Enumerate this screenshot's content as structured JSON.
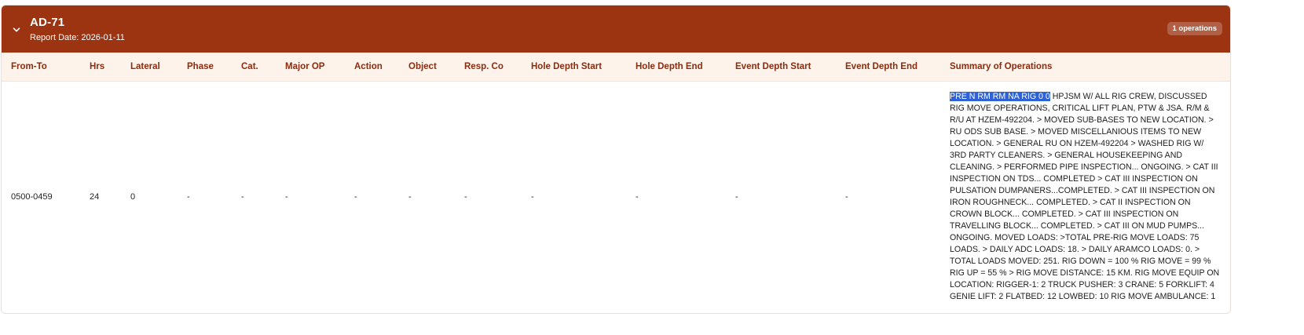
{
  "report": {
    "title": "AD-71",
    "report_date": "Report Date: 2026-01-11",
    "operations_badge": "1 operations"
  },
  "table": {
    "columns": [
      "From-To",
      "Hrs",
      "Lateral",
      "Phase",
      "Cat.",
      "Major OP",
      "Action",
      "Object",
      "Resp. Co",
      "Hole Depth Start",
      "Hole Depth End",
      "Event Depth Start",
      "Event Depth End",
      "Summary of Operations"
    ],
    "rows": [
      {
        "from_to": "0500-0459",
        "hrs": "24",
        "lateral": "0",
        "phase": "-",
        "cat": "-",
        "major_op": "-",
        "action": "-",
        "object": "-",
        "resp_co": "-",
        "hole_depth_start": "-",
        "hole_depth_end": "-",
        "event_depth_start": "-",
        "event_depth_end": "-",
        "summary_selected": "PRE N RM RM NA RIG 0 0",
        "summary_rest": " HPJSM W/ ALL RIG CREW, DISCUSSED RIG MOVE OPERATIONS, CRITICAL LIFT PLAN, PTW & JSA. R/M & R/U AT HZEM-492204. > MOVED SUB-BASES TO NEW LOCATION. > RU ODS SUB BASE. > MOVED MISCELLANIOUS ITEMS TO NEW LOCATION. > GENERAL RU ON HZEM-492204 > WASHED RIG W/ 3RD PARTY CLEANERS. > GENERAL HOUSEKEEPING AND CLEANING. > PERFORMED PIPE INSPECTION... ONGOING. > CAT III INSPECTION ON TDS... COMPLETED > CAT III INSPECTION ON PULSATION DUMPANERS...COMPLETED. > CAT III INSPECTION ON IRON ROUGHNECK... COMPLETED. > CAT II INSPECTION ON CROWN BLOCK... COMPLETED. > CAT III INSPECTION ON TRAVELLING BLOCK... COMPLETED. > CAT III ON MUD PUMPS... ONGOING. MOVED LOADS: >TOTAL PRE-RIG MOVE LOADS: 75 LOADS. > DAILY ADC LOADS: 18. > DAILY ARAMCO LOADS: 0. > TOTAL LOADS MOVED: 251. RIG DOWN = 100 % RIG MOVE = 99 % RIG UP = 55 % > RIG MOVE DISTANCE: 15 KM. RIG MOVE EQUIP ON LOCATION: RIGGER-1: 2 TRUCK PUSHER: 3 CRANE: 5 FORKLIFT: 4 GENIE LIFT: 2 FLATBED: 12 LOWBED: 10 RIG MOVE AMBULANCE: 1"
      }
    ]
  },
  "icons": {
    "collapse": "chevron-down-icon"
  },
  "colors": {
    "header_bg": "#9c3412",
    "column_header_bg": "#fdf3ea",
    "column_header_text": "#8a2c0f",
    "selection": "#2f62d6"
  }
}
